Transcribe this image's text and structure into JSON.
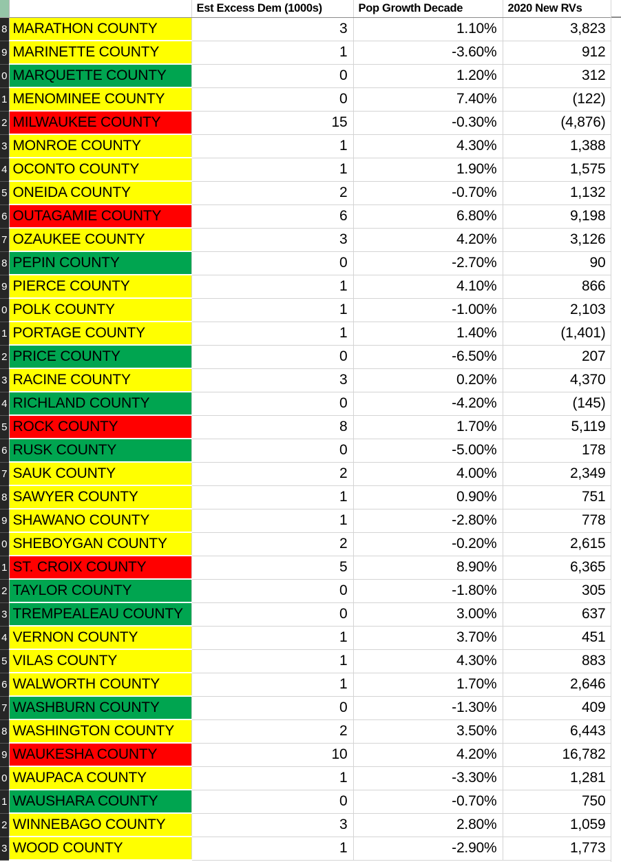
{
  "app": {
    "type": "spreadsheet",
    "row_header_color": "#262626",
    "row_header_corner_color": "#95c6a8"
  },
  "table": {
    "columns": [
      {
        "key": "rownum",
        "label": "",
        "align": "right"
      },
      {
        "key": "county",
        "label": "",
        "align": "left"
      },
      {
        "key": "est_excess_dem",
        "label": "Est Excess Dem (1000s)",
        "align": "right"
      },
      {
        "key": "pop_growth_decade",
        "label": "Pop Growth Decade",
        "align": "right"
      },
      {
        "key": "new_rvs_2020",
        "label": "2020 New RVs",
        "align": "right"
      }
    ],
    "highlight_colors": {
      "yellow": "#ffff00",
      "green": "#00a550",
      "red": "#ff0000"
    },
    "rows": [
      {
        "rownum": "8",
        "county": "MARATHON COUNTY",
        "fill": "yellow",
        "est_excess_dem": "3",
        "pop_growth_decade": "1.10%",
        "new_rvs_2020": "3,823"
      },
      {
        "rownum": "9",
        "county": "MARINETTE COUNTY",
        "fill": "yellow",
        "est_excess_dem": "1",
        "pop_growth_decade": "-3.60%",
        "new_rvs_2020": "912"
      },
      {
        "rownum": "0",
        "county": "MARQUETTE COUNTY",
        "fill": "green",
        "est_excess_dem": "0",
        "pop_growth_decade": "1.20%",
        "new_rvs_2020": "312"
      },
      {
        "rownum": "1",
        "county": "MENOMINEE COUNTY",
        "fill": "yellow",
        "est_excess_dem": "0",
        "pop_growth_decade": "7.40%",
        "new_rvs_2020": "(122)"
      },
      {
        "rownum": "2",
        "county": "MILWAUKEE COUNTY",
        "fill": "red",
        "est_excess_dem": "15",
        "pop_growth_decade": "-0.30%",
        "new_rvs_2020": "(4,876)"
      },
      {
        "rownum": "3",
        "county": "MONROE COUNTY",
        "fill": "yellow",
        "est_excess_dem": "1",
        "pop_growth_decade": "4.30%",
        "new_rvs_2020": "1,388"
      },
      {
        "rownum": "4",
        "county": "OCONTO COUNTY",
        "fill": "yellow",
        "est_excess_dem": "1",
        "pop_growth_decade": "1.90%",
        "new_rvs_2020": "1,575"
      },
      {
        "rownum": "5",
        "county": "ONEIDA COUNTY",
        "fill": "yellow",
        "est_excess_dem": "2",
        "pop_growth_decade": "-0.70%",
        "new_rvs_2020": "1,132"
      },
      {
        "rownum": "6",
        "county": "OUTAGAMIE COUNTY",
        "fill": "red",
        "est_excess_dem": "6",
        "pop_growth_decade": "6.80%",
        "new_rvs_2020": "9,198"
      },
      {
        "rownum": "7",
        "county": "OZAUKEE COUNTY",
        "fill": "yellow",
        "est_excess_dem": "3",
        "pop_growth_decade": "4.20%",
        "new_rvs_2020": "3,126"
      },
      {
        "rownum": "8",
        "county": "PEPIN COUNTY",
        "fill": "green",
        "est_excess_dem": "0",
        "pop_growth_decade": "-2.70%",
        "new_rvs_2020": "90"
      },
      {
        "rownum": "9",
        "county": "PIERCE COUNTY",
        "fill": "yellow",
        "est_excess_dem": "1",
        "pop_growth_decade": "4.10%",
        "new_rvs_2020": "866"
      },
      {
        "rownum": "0",
        "county": "POLK COUNTY",
        "fill": "yellow",
        "est_excess_dem": "1",
        "pop_growth_decade": "-1.00%",
        "new_rvs_2020": "2,103"
      },
      {
        "rownum": "1",
        "county": "PORTAGE COUNTY",
        "fill": "yellow",
        "est_excess_dem": "1",
        "pop_growth_decade": "1.40%",
        "new_rvs_2020": "(1,401)"
      },
      {
        "rownum": "2",
        "county": "PRICE COUNTY",
        "fill": "green",
        "est_excess_dem": "0",
        "pop_growth_decade": "-6.50%",
        "new_rvs_2020": "207"
      },
      {
        "rownum": "3",
        "county": "RACINE COUNTY",
        "fill": "yellow",
        "est_excess_dem": "3",
        "pop_growth_decade": "0.20%",
        "new_rvs_2020": "4,370"
      },
      {
        "rownum": "4",
        "county": "RICHLAND COUNTY",
        "fill": "green",
        "est_excess_dem": "0",
        "pop_growth_decade": "-4.20%",
        "new_rvs_2020": "(145)"
      },
      {
        "rownum": "5",
        "county": "ROCK COUNTY",
        "fill": "red",
        "est_excess_dem": "8",
        "pop_growth_decade": "1.70%",
        "new_rvs_2020": "5,119"
      },
      {
        "rownum": "6",
        "county": "RUSK COUNTY",
        "fill": "green",
        "est_excess_dem": "0",
        "pop_growth_decade": "-5.00%",
        "new_rvs_2020": "178"
      },
      {
        "rownum": "7",
        "county": "SAUK COUNTY",
        "fill": "yellow",
        "est_excess_dem": "2",
        "pop_growth_decade": "4.00%",
        "new_rvs_2020": "2,349"
      },
      {
        "rownum": "8",
        "county": "SAWYER COUNTY",
        "fill": "yellow",
        "est_excess_dem": "1",
        "pop_growth_decade": "0.90%",
        "new_rvs_2020": "751"
      },
      {
        "rownum": "9",
        "county": "SHAWANO COUNTY",
        "fill": "yellow",
        "est_excess_dem": "1",
        "pop_growth_decade": "-2.80%",
        "new_rvs_2020": "778"
      },
      {
        "rownum": "0",
        "county": "SHEBOYGAN COUNTY",
        "fill": "yellow",
        "est_excess_dem": "2",
        "pop_growth_decade": "-0.20%",
        "new_rvs_2020": "2,615"
      },
      {
        "rownum": "1",
        "county": "ST. CROIX COUNTY",
        "fill": "red",
        "est_excess_dem": "5",
        "pop_growth_decade": "8.90%",
        "new_rvs_2020": "6,365"
      },
      {
        "rownum": "2",
        "county": "TAYLOR COUNTY",
        "fill": "green",
        "est_excess_dem": "0",
        "pop_growth_decade": "-1.80%",
        "new_rvs_2020": "305"
      },
      {
        "rownum": "3",
        "county": "TREMPEALEAU COUNTY",
        "fill": "green",
        "est_excess_dem": "0",
        "pop_growth_decade": "3.00%",
        "new_rvs_2020": "637"
      },
      {
        "rownum": "4",
        "county": "VERNON COUNTY",
        "fill": "yellow",
        "est_excess_dem": "1",
        "pop_growth_decade": "3.70%",
        "new_rvs_2020": "451"
      },
      {
        "rownum": "5",
        "county": "VILAS COUNTY",
        "fill": "yellow",
        "est_excess_dem": "1",
        "pop_growth_decade": "4.30%",
        "new_rvs_2020": "883"
      },
      {
        "rownum": "6",
        "county": "WALWORTH COUNTY",
        "fill": "yellow",
        "est_excess_dem": "1",
        "pop_growth_decade": "1.70%",
        "new_rvs_2020": "2,646"
      },
      {
        "rownum": "7",
        "county": "WASHBURN COUNTY",
        "fill": "green",
        "est_excess_dem": "0",
        "pop_growth_decade": "-1.30%",
        "new_rvs_2020": "409"
      },
      {
        "rownum": "8",
        "county": "WASHINGTON COUNTY",
        "fill": "yellow",
        "est_excess_dem": "2",
        "pop_growth_decade": "3.50%",
        "new_rvs_2020": "6,443"
      },
      {
        "rownum": "9",
        "county": "WAUKESHA COUNTY",
        "fill": "red",
        "est_excess_dem": "10",
        "pop_growth_decade": "4.20%",
        "new_rvs_2020": "16,782"
      },
      {
        "rownum": "0",
        "county": "WAUPACA COUNTY",
        "fill": "yellow",
        "est_excess_dem": "1",
        "pop_growth_decade": "-3.30%",
        "new_rvs_2020": "1,281"
      },
      {
        "rownum": "1",
        "county": "WAUSHARA COUNTY",
        "fill": "green",
        "est_excess_dem": "0",
        "pop_growth_decade": "-0.70%",
        "new_rvs_2020": "750"
      },
      {
        "rownum": "2",
        "county": "WINNEBAGO COUNTY",
        "fill": "yellow",
        "est_excess_dem": "3",
        "pop_growth_decade": "2.80%",
        "new_rvs_2020": "1,059"
      },
      {
        "rownum": "3",
        "county": "WOOD COUNTY",
        "fill": "yellow",
        "est_excess_dem": "1",
        "pop_growth_decade": "-2.90%",
        "new_rvs_2020": "1,773"
      }
    ]
  }
}
